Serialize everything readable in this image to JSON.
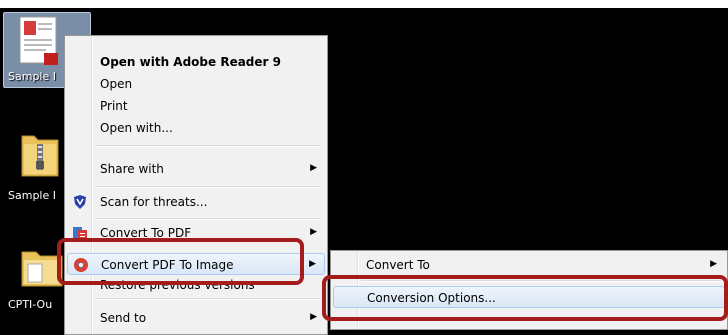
{
  "desktop": {
    "icons": [
      {
        "label": "Sample I",
        "icon": "pdf-document-icon"
      },
      {
        "label": "Sample I",
        "icon": "zip-folder-icon"
      },
      {
        "label": "CPTI-Ou",
        "icon": "folder-icon"
      }
    ]
  },
  "context_menu": {
    "items": [
      {
        "label": "Open with Adobe Reader 9",
        "bold": true
      },
      {
        "label": "Open"
      },
      {
        "label": "Print"
      },
      {
        "label": "Open with..."
      },
      {
        "label": "Share with",
        "submenu": true
      },
      {
        "label": "Scan for threats...",
        "icon": "shield-icon"
      },
      {
        "label": "Convert To PDF",
        "icon": "convert-to-pdf-icon",
        "submenu": true
      },
      {
        "label": "Convert PDF To Image",
        "icon": "convert-pdf-to-image-icon",
        "submenu": true,
        "highlighted": true
      },
      {
        "label": "Restore previous versions"
      },
      {
        "label": "Send to",
        "submenu": true
      }
    ]
  },
  "submenu": {
    "items": [
      {
        "label": "Convert To",
        "submenu": true
      },
      {
        "label": "Conversion Options...",
        "highlighted": true
      }
    ]
  },
  "colors": {
    "callout": "#a41c1c",
    "desktop": "#000000"
  }
}
